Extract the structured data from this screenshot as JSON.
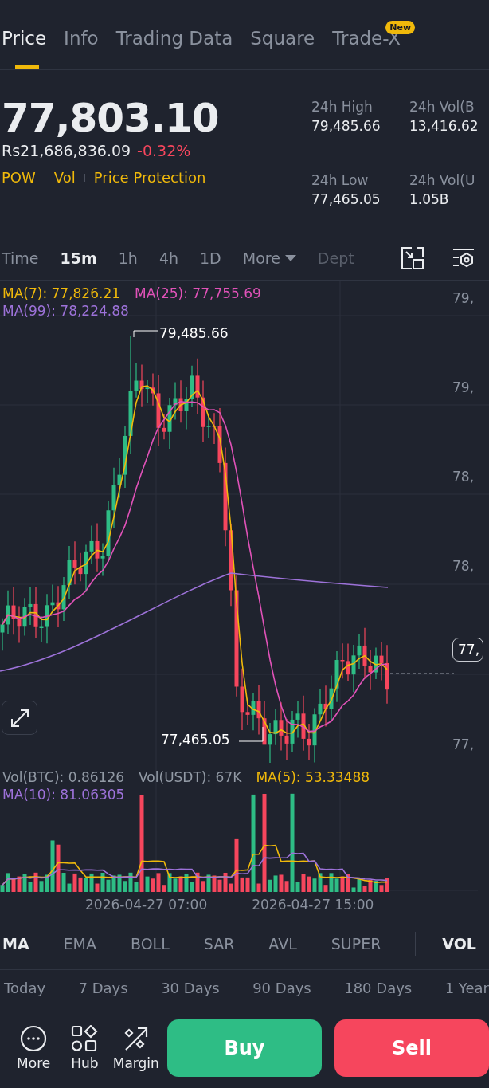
{
  "tabs": [
    {
      "label": "Price",
      "selected": true
    },
    {
      "label": "Info",
      "selected": false
    },
    {
      "label": "Trading Data",
      "selected": false
    },
    {
      "label": "Square",
      "selected": false
    },
    {
      "label": "Trade-X",
      "selected": false,
      "badge": "New"
    }
  ],
  "price": {
    "last": "77,803.10",
    "fiat": "Rs21,686,836.09",
    "change": "-0.32%",
    "tags": [
      "POW",
      "Vol",
      "Price Protection"
    ]
  },
  "stats": [
    {
      "label": "24h High",
      "value": "79,485.66"
    },
    {
      "label": "24h Vol(B",
      "value": "13,416.62"
    },
    {
      "label": "24h Low",
      "value": "77,465.05"
    },
    {
      "label": "24h Vol(U",
      "value": "1.05B"
    }
  ],
  "intervals": [
    {
      "label": "Time",
      "selected": false,
      "kind": "plain"
    },
    {
      "label": "15m",
      "selected": true,
      "kind": "plain"
    },
    {
      "label": "1h",
      "selected": false,
      "kind": "plain"
    },
    {
      "label": "4h",
      "selected": false,
      "kind": "plain"
    },
    {
      "label": "1D",
      "selected": false,
      "kind": "plain"
    },
    {
      "label": "More",
      "selected": false,
      "kind": "dropdown"
    },
    {
      "label": "Dept",
      "selected": false,
      "kind": "faded"
    }
  ],
  "chart": {
    "legend": [
      {
        "text": "MA(7): 77,826.21",
        "color": "#f0b90b"
      },
      {
        "text": "MA(25): 77,755.69",
        "color": "#e052b8"
      },
      {
        "text": "MA(99): 78,224.88",
        "color": "#9d72d9"
      }
    ],
    "axis": [
      "79,",
      "79,",
      "78,",
      "78,",
      "77,"
    ],
    "last_tag": "77,",
    "high_label": "79,485.66",
    "low_label": "77,465.05"
  },
  "volume": {
    "legend": [
      {
        "text": "Vol(BTC): 0.86126",
        "color": "#929aa5"
      },
      {
        "text": "Vol(USDT): 67K",
        "color": "#929aa5"
      },
      {
        "text": "MA(5): 53.33488",
        "color": "#f0b90b"
      },
      {
        "text": "MA(10): 81.06305",
        "color": "#9d72d9"
      }
    ],
    "dates": [
      "2026-04-27 07:00",
      "2026-04-27 15:00"
    ]
  },
  "indicators": [
    {
      "label": "MA",
      "selected": true,
      "separator_before": false
    },
    {
      "label": "EMA",
      "selected": false,
      "separator_before": false
    },
    {
      "label": "BOLL",
      "selected": false,
      "separator_before": false
    },
    {
      "label": "SAR",
      "selected": false,
      "separator_before": false
    },
    {
      "label": "AVL",
      "selected": false,
      "separator_before": false
    },
    {
      "label": "SUPER",
      "selected": false,
      "separator_before": false
    },
    {
      "label": "VOL",
      "selected": true,
      "separator_before": true
    }
  ],
  "periods": [
    "Today",
    "7 Days",
    "30 Days",
    "90 Days",
    "180 Days",
    "1 Year"
  ],
  "bottom_bar": {
    "actions": [
      {
        "label": "More",
        "kind": "more"
      },
      {
        "label": "Hub",
        "kind": "hub"
      },
      {
        "label": "Margin",
        "kind": "margin"
      }
    ],
    "buy": "Buy",
    "sell": "Sell"
  }
}
